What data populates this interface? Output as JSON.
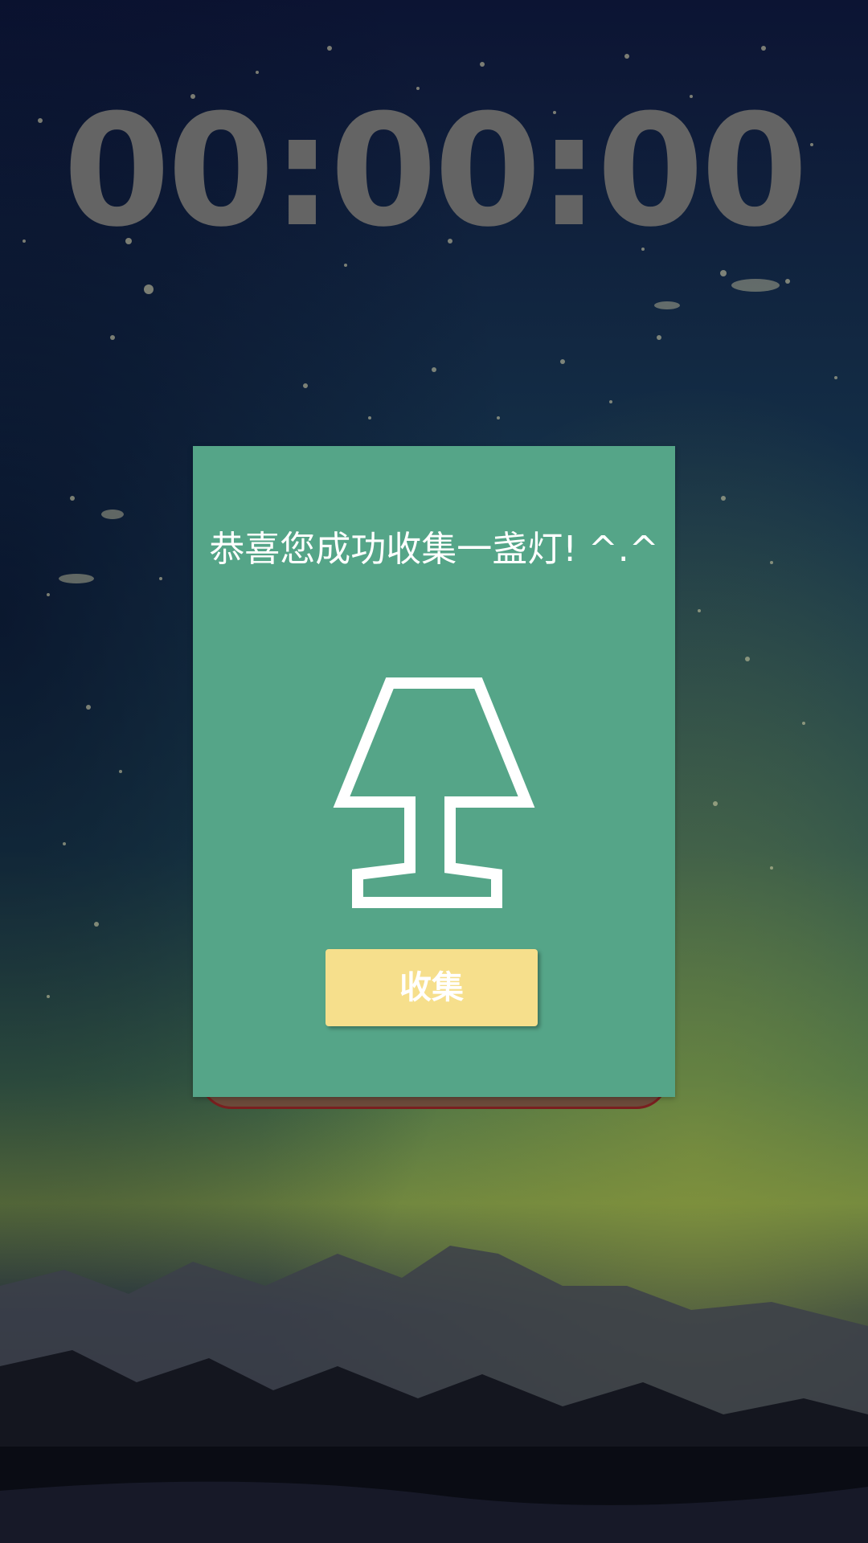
{
  "timer": {
    "display": "00:00:00"
  },
  "dialog": {
    "message": "恭喜您成功收集一盏灯! ^.^",
    "icon": "lamp-icon",
    "collect_label": "收集"
  },
  "colors": {
    "dialog_background": "#55a588",
    "button_background": "#f6df8c",
    "timer_text": "#646464",
    "sky": "#0b1530"
  }
}
